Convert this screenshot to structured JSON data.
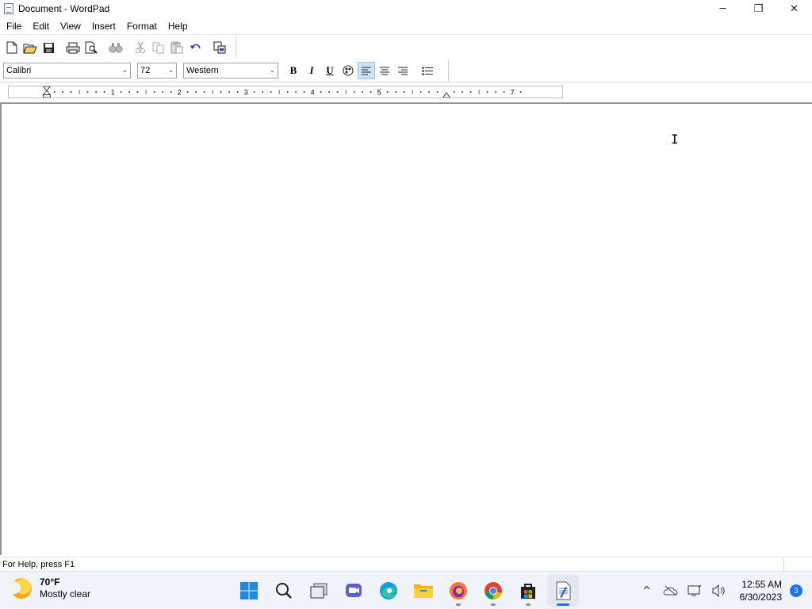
{
  "window": {
    "title": "Document - WordPad",
    "controls": {
      "minimize": "─",
      "maximize": "❐",
      "close": "✕"
    }
  },
  "menu": [
    "File",
    "Edit",
    "View",
    "Insert",
    "Format",
    "Help"
  ],
  "toolbar": {
    "icons": [
      "new-icon",
      "open-icon",
      "save-icon",
      "print-icon",
      "print-preview-icon",
      "find-icon",
      "cut-icon",
      "copy-icon",
      "paste-icon",
      "undo-icon",
      "insert-object-icon"
    ]
  },
  "format": {
    "font": "Calibri",
    "size": "72",
    "script": "Western",
    "bold": "B",
    "italic": "I",
    "underline": "U",
    "dropdown_arrow": "⌄",
    "alignment_active": "left"
  },
  "ruler": {
    "numbers": [
      "1",
      "2",
      "3",
      "4",
      "5",
      "7"
    ]
  },
  "status": {
    "help_text": "For Help, press F1"
  },
  "taskbar": {
    "weather_temp": "70°F",
    "weather_condition": "Mostly clear",
    "apps": [
      "start",
      "search",
      "task-view",
      "teams",
      "edge",
      "file-explorer",
      "firefox",
      "chrome",
      "store",
      "wordpad"
    ],
    "active_app": "wordpad",
    "tray_chevron": "^",
    "time": "12:55 AM",
    "date": "6/30/2023",
    "notifications": "3"
  },
  "colors": {
    "accent": "#1a73e8",
    "active_toolbar": "#cfe3f7"
  }
}
